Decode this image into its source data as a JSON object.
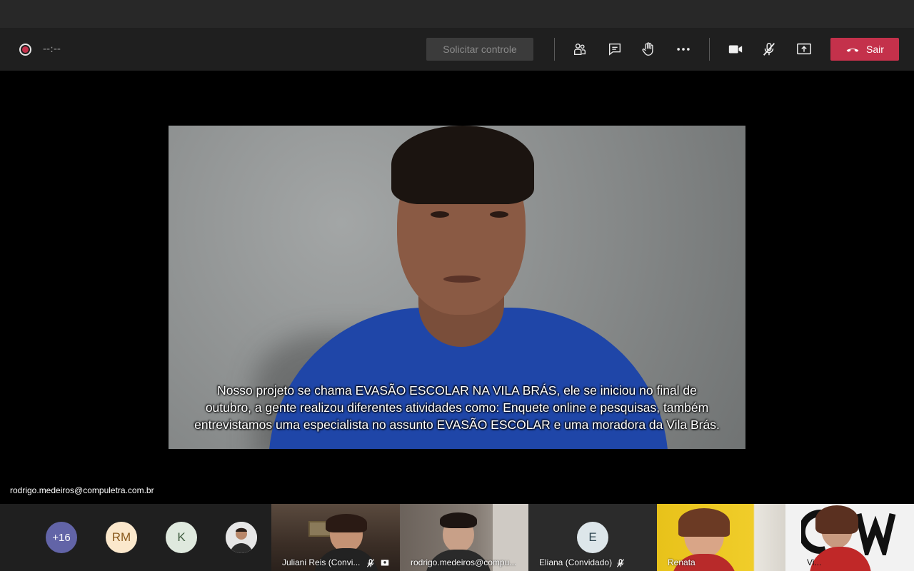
{
  "call": {
    "timer": "--:--",
    "request_control_label": "Solicitar controle",
    "leave_label": "Sair"
  },
  "toolbar_icons": [
    "participants-icon",
    "chat-icon",
    "raise-hand-icon",
    "more-options-icon",
    "camera-icon",
    "mic-muted-icon",
    "share-screen-icon",
    "hang-up-icon"
  ],
  "stage": {
    "caption_lines": [
      "Nosso projeto se chama EVASÃO ESCOLAR NA VILA BRÁS, ele se iniciou no final de",
      "outubro, a gente realizou diferentes atividades como: Enquete online e pesquisas, também",
      "entrevistamos uma especialista no assunto EVASÃO ESCOLAR e uma moradora da Vila Brás."
    ],
    "speaker_name": "rodrigo.medeiros@compuletra.com.br"
  },
  "participants": {
    "overflow_count": "+16",
    "avatars": [
      {
        "initials": "RM",
        "bg": "#fbe8cc",
        "fg": "#8a5a1e"
      },
      {
        "initials": "K",
        "bg": "#dfe9de",
        "fg": "#3d5a3d"
      }
    ],
    "tiles": [
      {
        "name": "Juliani Reis (Convi..."
      },
      {
        "name": "rodrigo.medeiros@compu..."
      },
      {
        "name": "Eliana (Convidado)",
        "initials": "E"
      },
      {
        "name": "Renata"
      },
      {
        "name": "Vi..."
      }
    ]
  },
  "colors": {
    "leave": "#c4314b",
    "overflow_avatar": "#6264a7",
    "toolbar_bg": "#1f1f1f"
  }
}
